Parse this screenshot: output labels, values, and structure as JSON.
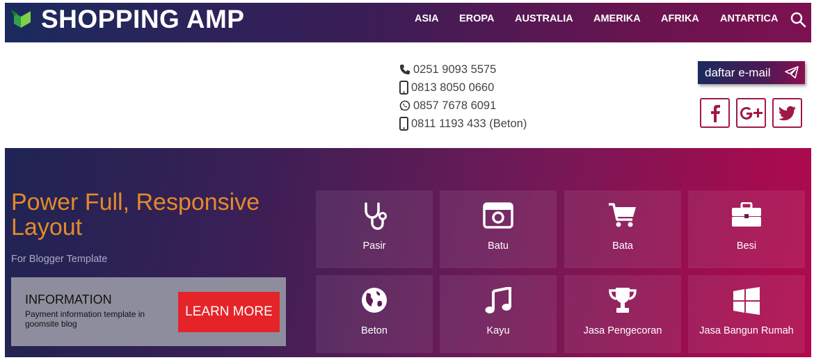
{
  "header": {
    "logo_text": "SHOPPING AMP",
    "nav": [
      "ASIA",
      "EROPA",
      "AUSTRALIA",
      "AMERIKA",
      "AFRIKA",
      "ANTARTICA"
    ]
  },
  "contact": {
    "phones": [
      {
        "icon": "phone-icon",
        "text": "0251 9093 5575"
      },
      {
        "icon": "mobile-icon",
        "text": "0813 8050 0660"
      },
      {
        "icon": "whatsapp-icon",
        "text": "0857 7678 6091"
      },
      {
        "icon": "mobile-icon",
        "text": "0811 1193 433 (Beton)"
      }
    ],
    "email_button": "daftar e-mail",
    "social": [
      "facebook-icon",
      "google-plus-icon",
      "twitter-icon"
    ]
  },
  "hero": {
    "title": "Power Full, Responsive Layout",
    "subtitle": "For Blogger Template",
    "info": {
      "title": "INFORMATION",
      "description": "Payment information template in goomsite blog",
      "button": "LEARN MORE"
    },
    "tiles": [
      {
        "label": "Pasir",
        "icon": "stethoscope-icon"
      },
      {
        "label": "Batu",
        "icon": "camera-icon"
      },
      {
        "label": "Bata",
        "icon": "cart-icon"
      },
      {
        "label": "Besi",
        "icon": "briefcase-icon"
      },
      {
        "label": "Beton",
        "icon": "globe-icon"
      },
      {
        "label": "Kayu",
        "icon": "music-icon"
      },
      {
        "label": "Jasa Pengecoran",
        "icon": "trophy-icon"
      },
      {
        "label": "Jasa Bangun Rumah",
        "icon": "windows-icon"
      }
    ]
  },
  "colors": {
    "accent_orange": "#e38a2a",
    "button_red": "#e5242a",
    "social_border": "#a0184a"
  }
}
